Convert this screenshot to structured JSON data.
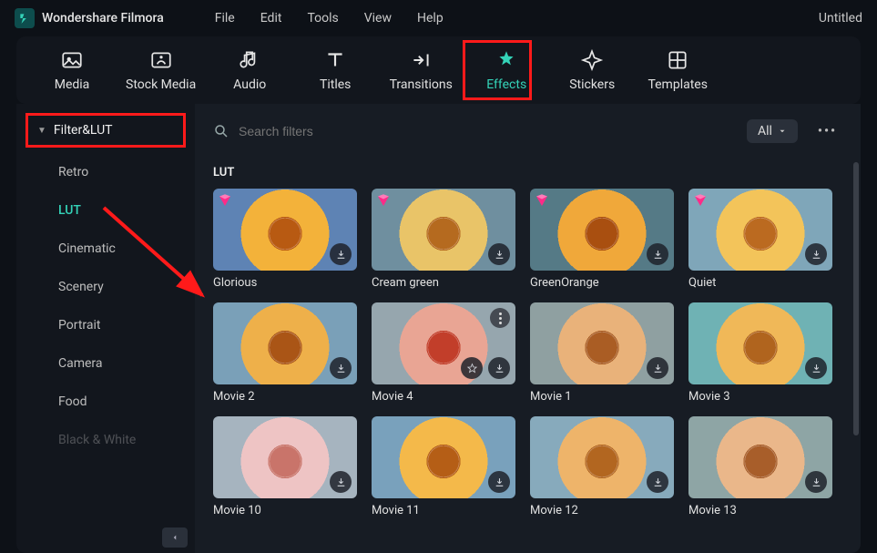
{
  "app": {
    "name": "Wondershare Filmora",
    "document": "Untitled"
  },
  "menu": [
    "File",
    "Edit",
    "Tools",
    "View",
    "Help"
  ],
  "tabs": [
    {
      "label": "Media"
    },
    {
      "label": "Stock Media"
    },
    {
      "label": "Audio"
    },
    {
      "label": "Titles"
    },
    {
      "label": "Transitions"
    },
    {
      "label": "Effects",
      "active": true
    },
    {
      "label": "Stickers"
    },
    {
      "label": "Templates"
    }
  ],
  "sidebar": {
    "heading": "Filter&LUT",
    "items": [
      {
        "label": "Retro"
      },
      {
        "label": "LUT",
        "active": true
      },
      {
        "label": "Cinematic"
      },
      {
        "label": "Scenery"
      },
      {
        "label": "Portrait"
      },
      {
        "label": "Camera"
      },
      {
        "label": "Food"
      },
      {
        "label": "Black & White",
        "faded": true
      }
    ]
  },
  "search": {
    "placeholder": "Search filters"
  },
  "filter_label": "All",
  "section_title": "LUT",
  "cards": [
    {
      "label": "Glorious",
      "premium": true,
      "bg": "#5e83b4",
      "pt": "#f3b23a",
      "cn": "#b85a12"
    },
    {
      "label": "Cream green",
      "premium": true,
      "bg": "#6f8f9f",
      "pt": "#e9c468",
      "cn": "#b56a1f"
    },
    {
      "label": "GreenOrange",
      "premium": true,
      "bg": "#557a86",
      "pt": "#f0a83a",
      "cn": "#a94f10"
    },
    {
      "label": "Quiet",
      "premium": true,
      "bg": "#7fa6b9",
      "pt": "#f3c45a",
      "cn": "#bb6a20"
    },
    {
      "label": "Movie 2",
      "bg": "#7aa0b8",
      "pt": "#eeb04a",
      "cn": "#aa5516"
    },
    {
      "label": "Movie 4",
      "bg": "#96a6ae",
      "pt": "#e9a594",
      "cn": "#c23e2a",
      "kebab": true,
      "star": true
    },
    {
      "label": "Movie 1",
      "bg": "#8fa0a1",
      "pt": "#e9b27a",
      "cn": "#aa5d24"
    },
    {
      "label": "Movie 3",
      "bg": "#6fb2b4",
      "pt": "#f0b858",
      "cn": "#b0641e"
    },
    {
      "label": "Movie 10",
      "bg": "#a6b4bf",
      "pt": "#eec4c4",
      "cn": "#c9746a"
    },
    {
      "label": "Movie 11",
      "bg": "#79a1bc",
      "pt": "#f4b94a",
      "cn": "#b55e16"
    },
    {
      "label": "Movie 12",
      "bg": "#87aabc",
      "pt": "#eeb46a",
      "cn": "#b26620"
    },
    {
      "label": "Movie 13",
      "bg": "#8ea5a5",
      "pt": "#eab78a",
      "cn": "#a85e2a"
    }
  ]
}
